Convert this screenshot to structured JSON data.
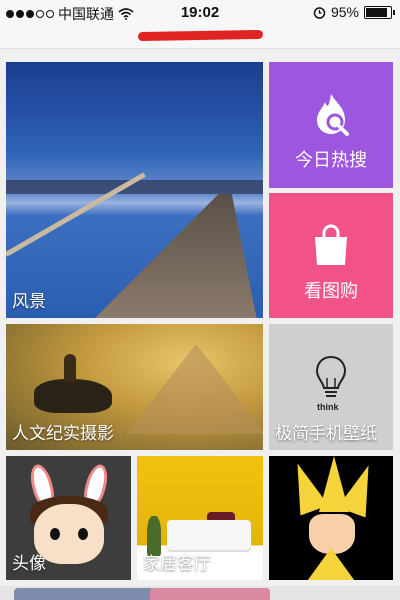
{
  "status_bar": {
    "carrier": "中国联通",
    "time": "19:02",
    "battery_percent": "95%",
    "battery_level": 0.95,
    "icons": [
      "signal-dots-icon",
      "wifi-icon",
      "alarm-icon",
      "battery-icon"
    ]
  },
  "address_bar": {
    "url_redacted": true
  },
  "tiles": {
    "scenery": {
      "label": "风景"
    },
    "today_hot": {
      "label": "今日热搜",
      "icon": "fire-search-icon",
      "color": "#9c56e0"
    },
    "shop": {
      "label": "看图购",
      "icon": "shopping-bag-icon",
      "color": "#f15386"
    },
    "humanities": {
      "label": "人文纪实摄影"
    },
    "minimal": {
      "label": "极简手机壁纸",
      "bulb_text": "think",
      "icon": "light-bulb-icon"
    },
    "avatar": {
      "label": "头像"
    },
    "living_room": {
      "label": "家居客厅"
    },
    "anime": {
      "label": ""
    }
  }
}
